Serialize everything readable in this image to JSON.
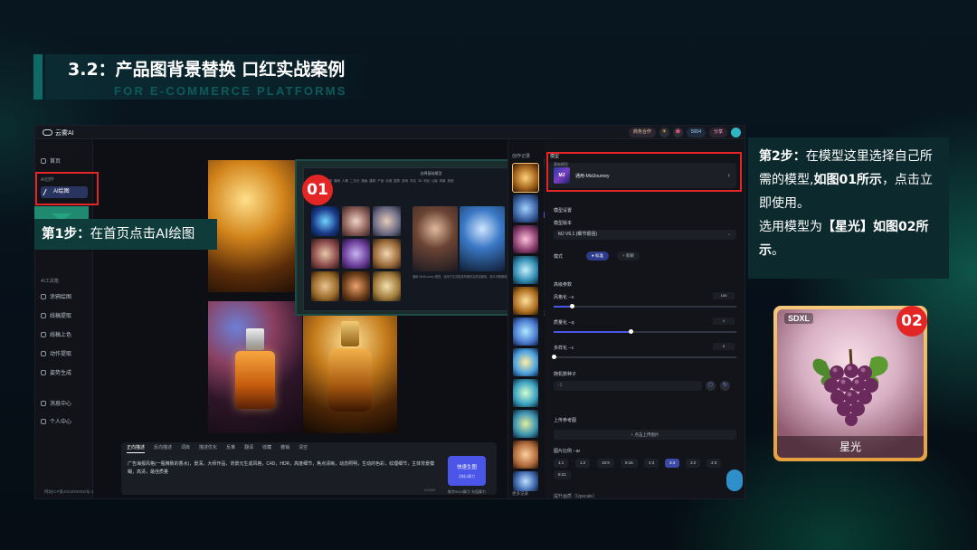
{
  "slide": {
    "title": "3.2：产品图背景替换  口红实战案例",
    "subtitle": "FOR E-COMMERCE PLATFORMS"
  },
  "app": {
    "logo": "云雾AI",
    "top_actions": [
      "商务合作",
      "☀",
      "⬟",
      "5004",
      "分享"
    ],
    "sidebar": {
      "home": "首页",
      "section_ai": "AI创作",
      "ai_draw": "AI绘图",
      "section_tools": "AI工具箱",
      "tools": [
        "涂鸦绘图",
        "线稿提取",
        "线稿上色",
        "动作提取",
        "姿势生成"
      ],
      "messages": "消息中心",
      "profile": "个人中心",
      "footer": "网站ICP备2023000000号-2"
    },
    "overlay": {
      "title": "选择基础模型",
      "tabs": [
        "全部",
        "通用",
        "人像",
        "二次元",
        "插画",
        "建筑",
        "产品",
        "动漫",
        "国风",
        "游戏",
        "写实",
        "3D",
        "科幻",
        "Q版",
        "风景",
        "其他"
      ],
      "use_button": "立即使用",
      "description": "通用-MidJourney 模型，适用于生成各类风格的高质量图像，提示词理解能力强，画面细节丰富。",
      "side_lines": [
        "模型类型  通用",
        "版本  V6.1",
        "作者  官方",
        "使用次数  12.5w",
        "收藏  3201",
        "更新时间  2024-08"
      ]
    },
    "prompt": {
      "tabs": [
        "正向描述",
        "反向描述",
        "词库",
        "描述优化",
        "反推",
        "翻译",
        "收藏",
        "撤销",
        "清空"
      ],
      "text": "广告海报风格(一瓶精致的香水)，景深，大师作品，背景元生成风格，C4D，HDR，高度细节，焦点清晰，动态照明，生动的色彩，纹理细节，主体背景模糊，高清，最佳质量",
      "count": "0/1500",
      "generate": "快速生图",
      "generate_sub": "消耗4算力",
      "balance": "剩余5004算力 充值算力"
    },
    "strip": {
      "head": "创作记录",
      "foot": "更多记录"
    },
    "panel": {
      "model_label": "模型",
      "model_sub": "基础模型",
      "model_name": "通用-MidJourney",
      "model_badge": "MJ",
      "settings": "模型设置",
      "version_label": "模型版本",
      "version_value": "MJ V6.1 (细节很强)",
      "mode_label": "模式",
      "mode_options": [
        "标准",
        "新颖"
      ],
      "advanced": "高级参数",
      "stylize_label": "风格化 --s",
      "stylize_value": "100",
      "quality_label": "质量化 --q",
      "quality_value": "1",
      "chaos_label": "多样化 --c",
      "chaos_value": "0",
      "seed_label": "随机数种子",
      "seed_placeholder": "-1",
      "ref_label": "上传参考图",
      "upload_label": "+ 点击上传图片",
      "ratio_label": "图片比例 --ar",
      "ratios": [
        "1:1",
        "1:2",
        "16:9",
        "9:16",
        "4:3",
        "3:4",
        "3:2",
        "2:3",
        "9:21"
      ],
      "ratio_selected": "3:4",
      "extra_label": "提升画质（Upscale）"
    }
  },
  "annotations": {
    "badge01": "01",
    "badge02": "02",
    "step1_bold": "第1步：",
    "step1_text": "在首页点击AI绘图",
    "step2_bold": "第2步：",
    "step2_text_a": "在模型这里选择自己所需的模型,",
    "step2_bold_b": "如图01所示",
    "step2_text_c": "，点击立即使用。",
    "step2_text_d": "选用模型为",
    "step2_bold_e": "【星光】如图02所示",
    "step2_text_f": "。",
    "card_badge": "SDXL",
    "card_label": "星光"
  },
  "colors": {
    "accent_blue": "#4b55e8",
    "highlight_red": "#e42525",
    "teal_panel": "#0f3b3a"
  },
  "slider_levels": {
    "stylize": 0.1,
    "quality": 0.42,
    "chaos": 0
  }
}
